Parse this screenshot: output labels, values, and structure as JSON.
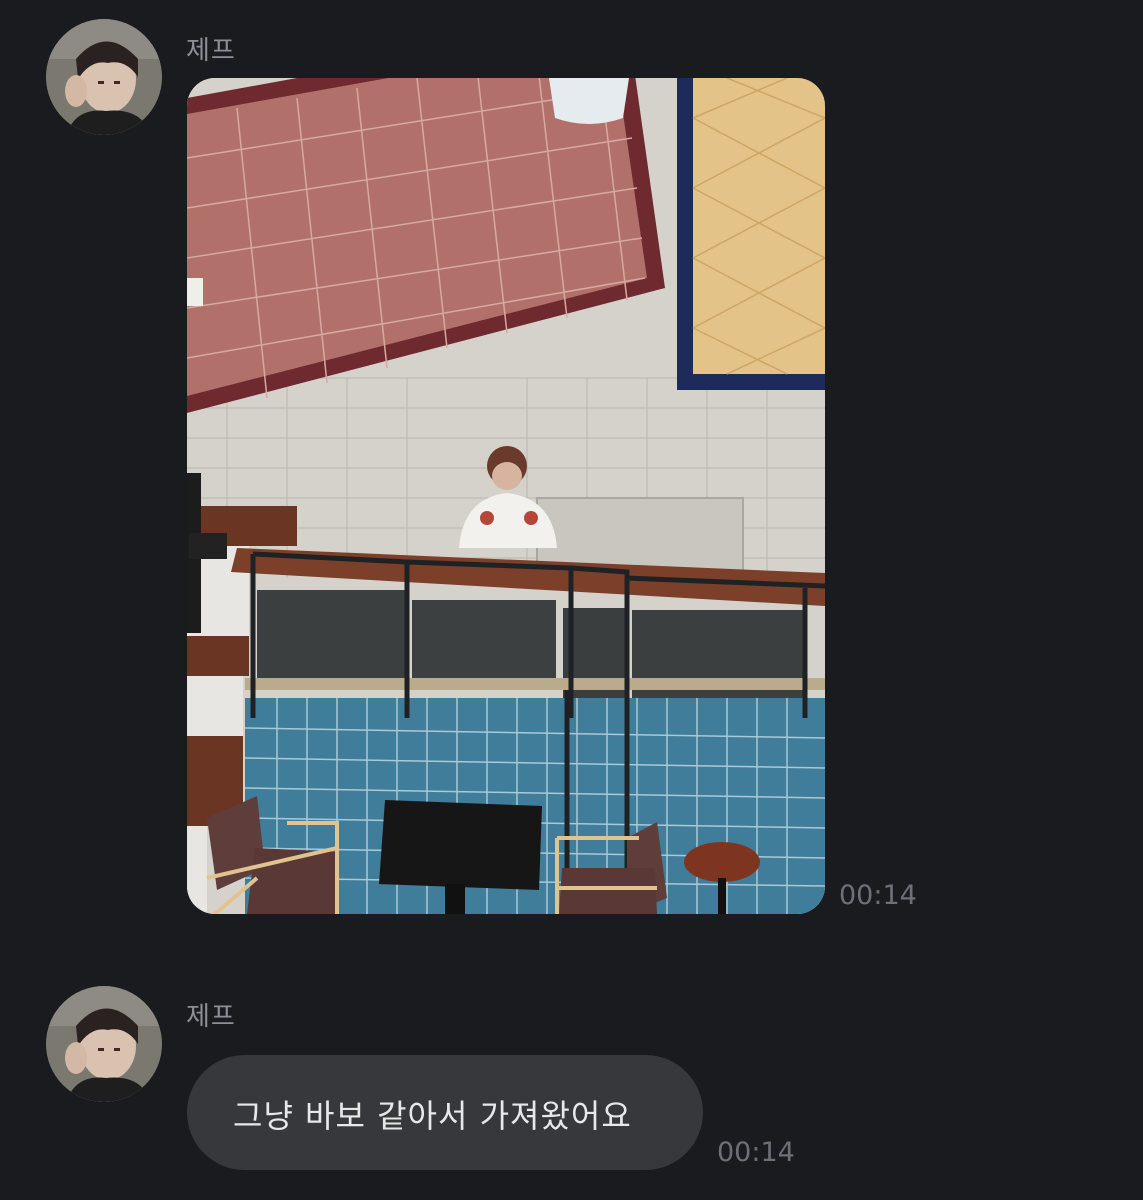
{
  "messages": [
    {
      "sender": "제프",
      "type": "image",
      "time": "00:14"
    },
    {
      "sender": "제프",
      "type": "text",
      "text": "그냥 바보 같아서 가져왔어요",
      "time": "00:14"
    }
  ],
  "icons": {
    "avatar": "sender-avatar-photo"
  },
  "colors": {
    "background": "#1a1b1f",
    "bubble": "#37383c",
    "sender_text": "#8e8f94",
    "time_text": "#6f7076"
  }
}
